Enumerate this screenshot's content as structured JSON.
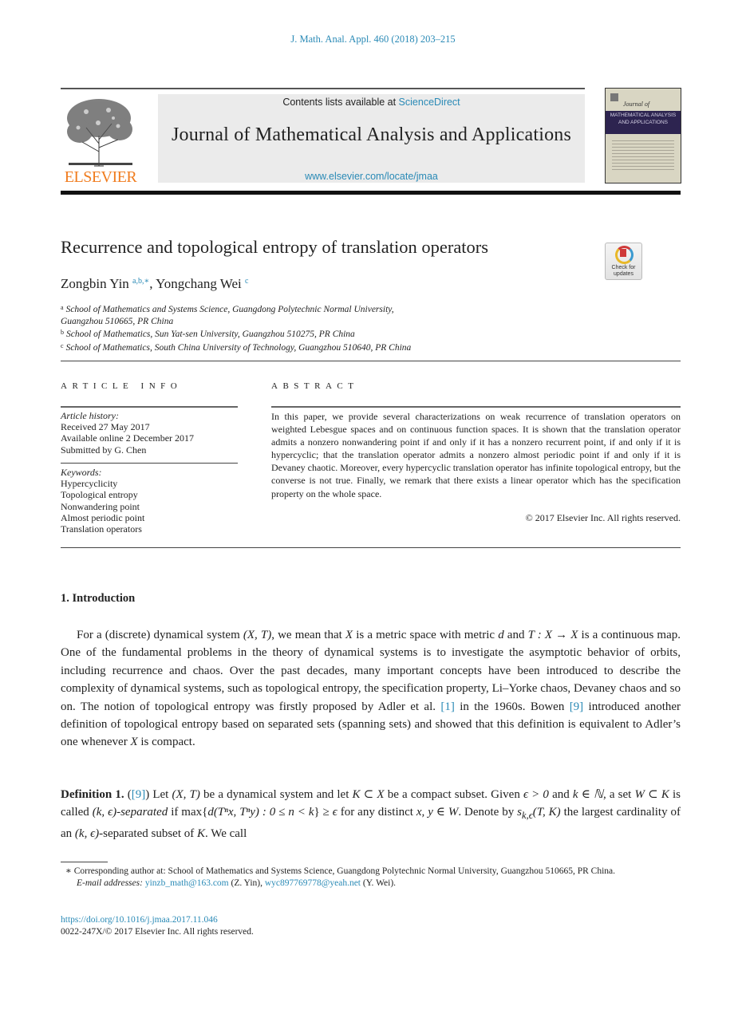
{
  "citation": "J. Math. Anal. Appl. 460 (2018) 203–215",
  "masthead": {
    "publisher_logo_text": "ELSEVIER",
    "contents_prefix": "Contents lists available at ",
    "contents_link": "ScienceDirect",
    "journal_title": "Journal of Mathematical Analysis and Applications",
    "journal_url": "www.elsevier.com/locate/jmaa",
    "cover_script": "Journal of",
    "cover_band": "MATHEMATICAL ANALYSIS AND APPLICATIONS",
    "colors": {
      "link": "#2a8ab6",
      "elsevier_orange": "#f07c1e",
      "cover_band": "#2d2450"
    }
  },
  "article": {
    "title": "Recurrence and topological entropy of translation operators",
    "crossmark_label_1": "Check for",
    "crossmark_label_2": "updates",
    "authors": [
      {
        "name": "Zongbin Yin",
        "sup": "a,b,∗"
      },
      {
        "name": "Yongchang Wei",
        "sup": "c"
      }
    ],
    "author_separator": ", ",
    "affiliations": [
      {
        "mark": "a",
        "text": "School of Mathematics and Systems Science, Guangdong Polytechnic Normal University,",
        "continuation": "Guangzhou 510665, PR China"
      },
      {
        "mark": "b",
        "text": "School of Mathematics, Sun Yat-sen University, Guangzhou 510275, PR China"
      },
      {
        "mark": "c",
        "text": "School of Mathematics, South China University of Technology, Guangzhou 510640, PR China"
      }
    ]
  },
  "article_info": {
    "heading": "ARTICLE INFO",
    "history_label": "Article history:",
    "history": [
      "Received 27 May 2017",
      "Available online 2 December 2017",
      "Submitted by G. Chen"
    ],
    "keywords_label": "Keywords:",
    "keywords": [
      "Hypercyclicity",
      "Topological entropy",
      "Nonwandering point",
      "Almost periodic point",
      "Translation operators"
    ]
  },
  "abstract": {
    "heading": "ABSTRACT",
    "text": "In this paper, we provide several characterizations on weak recurrence of translation operators on weighted Lebesgue spaces and on continuous function spaces. It is shown that the translation operator admits a nonzero nonwandering point if and only if it has a nonzero recurrent point, if and only if it is hypercyclic; that the translation operator admits a nonzero almost periodic point if and only if it is Devaney chaotic. Moreover, every hypercyclic translation operator has infinite topological entropy, but the converse is not true. Finally, we remark that there exists a linear operator which has the specification property on the whole space.",
    "copyright": "© 2017 Elsevier Inc. All rights reserved."
  },
  "section1": {
    "heading": "1. Introduction",
    "para": {
      "t1": "For a (discrete) dynamical system ",
      "m1": "(X, T)",
      "t2": ", we mean that ",
      "m2": "X",
      "t3": " is a metric space with metric ",
      "m3": "d",
      "t4": " and ",
      "m4": "T : X → X",
      "t5": " is a continuous map. One of the fundamental problems in the theory of dynamical systems is to investigate the asymptotic behavior of orbits, including recurrence and chaos. Over the past decades, many important concepts have been introduced to describe the complexity of dynamical systems, such as topological entropy, the specification property, Li–Yorke chaos, Devaney chaos and so on. The notion of topological entropy was firstly proposed by Adler et al. ",
      "ref1": "[1]",
      "t6": " in the 1960s. Bowen ",
      "ref2": "[9]",
      "t7": " introduced another definition of topological entropy based on separated sets (spanning sets) and showed that this definition is equivalent to Adler’s one whenever ",
      "m5": "X",
      "t8": " is compact."
    },
    "definition": {
      "label": "Definition 1.",
      "open": " (",
      "ref": "[9]",
      "t1": ") Let ",
      "m1": "(X, T)",
      "t2": " be a dynamical system and let ",
      "m2": "K ⊂ X",
      "t3": " be a compact subset. Given ",
      "m3": "ϵ > 0",
      "t4": " and ",
      "m4": "k ∈ ℕ",
      "t5": ", a set ",
      "m5": "W ⊂ K",
      "t6": " is called ",
      "m6": "(k, ϵ)-separated",
      "t7": " if max{",
      "m7": "d(Tⁿx, Tⁿy) : 0 ≤ n < k",
      "t8": "} ≥ ",
      "m8": "ϵ",
      "t9": " for any distinct ",
      "m9": "x, y ∈ W",
      "t10": ". Denote by ",
      "m10": "s",
      "m10_sub": "k,ϵ",
      "m11": "(T, K)",
      "t11": " the largest cardinality of an ",
      "m12": "(k, ϵ)",
      "t12": "-separated subset of ",
      "m13": "K",
      "t13": ". We call"
    }
  },
  "footnotes": {
    "star": "∗",
    "corresponding": " Corresponding author at: School of Mathematics and Systems Science, Guangdong Polytechnic Normal University, Guangzhou 510665, PR China.",
    "email_label": "E-mail addresses:",
    "email1": "yinzb_math@163.com",
    "email1_owner": " (Z. Yin), ",
    "email2": "wyc897769778@yeah.net",
    "email2_owner": " (Y. Wei).",
    "doi": "https://doi.org/10.1016/j.jmaa.2017.11.046",
    "issn": "0022-247X/© 2017 Elsevier Inc. All rights reserved."
  }
}
